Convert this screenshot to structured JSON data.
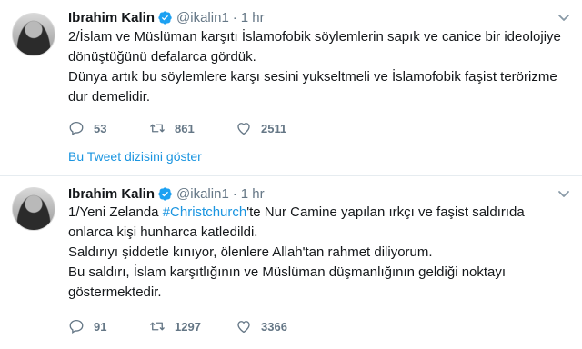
{
  "tweets": [
    {
      "name": "Ibrahim Kalin",
      "handle": "@ikalin1",
      "separator": "·",
      "time": "1 hr",
      "lines": [
        "2/İslam ve Müslüman karşıtı İslamofobik söylemlerin sapık ve canice bir ideolojiye",
        "dönüştüğünü defalarca gördük.",
        "Dünya artık bu söylemlere karşı sesini yukseltmeli ve İslamofobik faşist terörizme",
        "dur demelidir."
      ],
      "replies": "53",
      "retweets": "861",
      "likes": "2511",
      "thread_link": "Bu Tweet dizisini göster"
    },
    {
      "name": "Ibrahim Kalin",
      "handle": "@ikalin1",
      "separator": "·",
      "time": "1 hr",
      "line1_prefix": "1/Yeni Zelanda ",
      "hashtag": "#Christchurch",
      "line1_suffix": "'te Nur Camine yapılan ırkçı ve faşist saldırıda",
      "lines": [
        "onlarca kişi hunharca katledildi.",
        "Saldırıyı şiddetle kınıyor, ölenlere Allah'tan rahmet diliyorum.",
        "Bu saldırı, İslam karşıtlığının ve Müslüman düşmanlığının geldiği noktayı",
        "göstermektedir."
      ],
      "replies": "91",
      "retweets": "1297",
      "likes": "3366"
    }
  ],
  "icons": {
    "verified": "verified-badge-icon",
    "caret": "chevron-down-icon",
    "reply": "reply-icon",
    "retweet": "retweet-icon",
    "like": "heart-icon"
  },
  "colors": {
    "link": "#1b95e0",
    "muted": "#657786",
    "text": "#14171a"
  }
}
